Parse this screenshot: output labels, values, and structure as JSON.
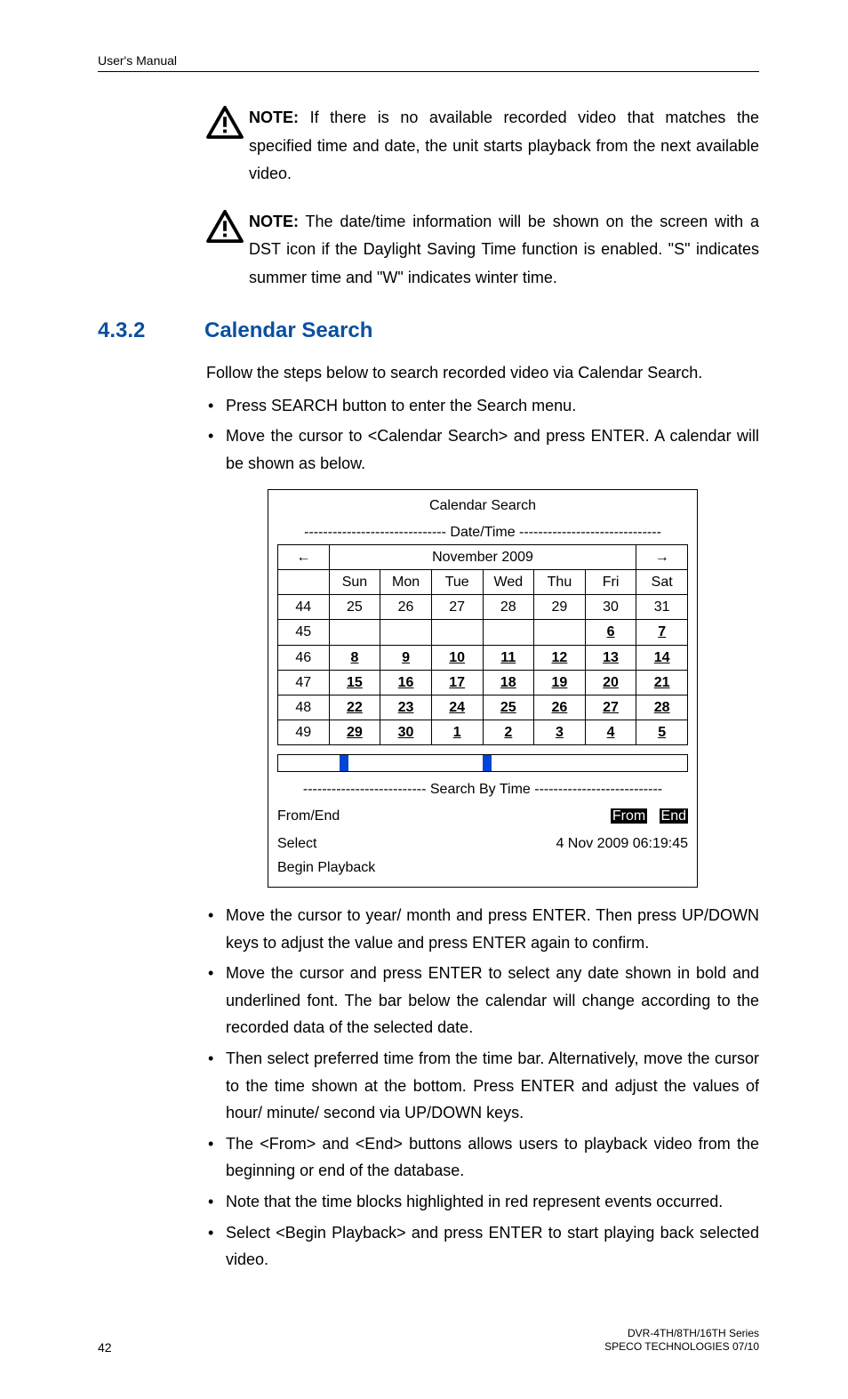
{
  "header": "User's Manual",
  "notes": {
    "n1": "If there is no available recorded video that matches the specified time and date, the unit starts playback from the next available video.",
    "n2": "The date/time information will be shown on the screen with a DST icon if the Daylight Saving Time function is enabled. \"S\" indicates summer time and \"W\" indicates winter time."
  },
  "section": {
    "num": "4.3.2",
    "title": "Calendar Search",
    "intro": "Follow the steps below to search recorded video via Calendar Search.",
    "bullets_top": [
      "Press SEARCH button to enter the Search menu.",
      "Move the cursor to <Calendar Search> and press ENTER. A calendar will be shown as below."
    ],
    "bullets_bottom": [
      "Move the cursor to year/ month and press ENTER. Then press UP/DOWN keys to adjust the value and press ENTER again to confirm.",
      "Move the cursor and press ENTER to select any date shown in bold and underlined font. The bar below the calendar will change according to the recorded data of the selected date.",
      "Then select preferred time from the time bar. Alternatively, move the cursor to the time shown at the bottom. Press ENTER and adjust the values of hour/ minute/ second via UP/DOWN keys.",
      "The <From> and <End> buttons allows users to playback video from the beginning or end of the database.",
      "Note that the time blocks highlighted in red represent events occurred.",
      "Select <Begin Playback> and press ENTER to start playing back selected video."
    ]
  },
  "calendar": {
    "title": "Calendar Search",
    "datetime_label": "------------------------------ Date/Time ------------------------------",
    "left_arrow": "←",
    "right_arrow": "→",
    "month": "November 2009",
    "dow": [
      "",
      "Sun",
      "Mon",
      "Tue",
      "Wed",
      "Thu",
      "Fri",
      "Sat"
    ],
    "rows": [
      {
        "wk": "44",
        "d": [
          "25",
          "26",
          "27",
          "28",
          "29",
          "30",
          "31"
        ],
        "bold": []
      },
      {
        "wk": "45",
        "d": [
          "",
          "",
          "",
          "",
          "",
          "6",
          "7"
        ],
        "bold": [
          5,
          6
        ]
      },
      {
        "wk": "46",
        "d": [
          "8",
          "9",
          "10",
          "11",
          "12",
          "13",
          "14"
        ],
        "bold": [
          0,
          1,
          2,
          3,
          4,
          5,
          6
        ]
      },
      {
        "wk": "47",
        "d": [
          "15",
          "16",
          "17",
          "18",
          "19",
          "20",
          "21"
        ],
        "bold": [
          0,
          1,
          2,
          3,
          4,
          5,
          6
        ]
      },
      {
        "wk": "48",
        "d": [
          "22",
          "23",
          "24",
          "25",
          "26",
          "27",
          "28"
        ],
        "bold": [
          0,
          1,
          2,
          3,
          4,
          5,
          6
        ]
      },
      {
        "wk": "49",
        "d": [
          "29",
          "30",
          "1",
          "2",
          "3",
          "4",
          "5"
        ],
        "bold": [
          0,
          1,
          2,
          3,
          4,
          5,
          6
        ]
      }
    ],
    "sbt_label": "-------------------------- Search By Time ---------------------------",
    "fromend_label": "From/End",
    "from_btn": "From",
    "end_btn": "End",
    "select_label": "Select",
    "select_value": "4  Nov  2009  06:19:45",
    "begin_label": "Begin Playback"
  },
  "footer": {
    "page": "42",
    "line1": "DVR-4TH/8TH/16TH Series",
    "line2": "SPECO TECHNOLOGIES 07/10"
  }
}
